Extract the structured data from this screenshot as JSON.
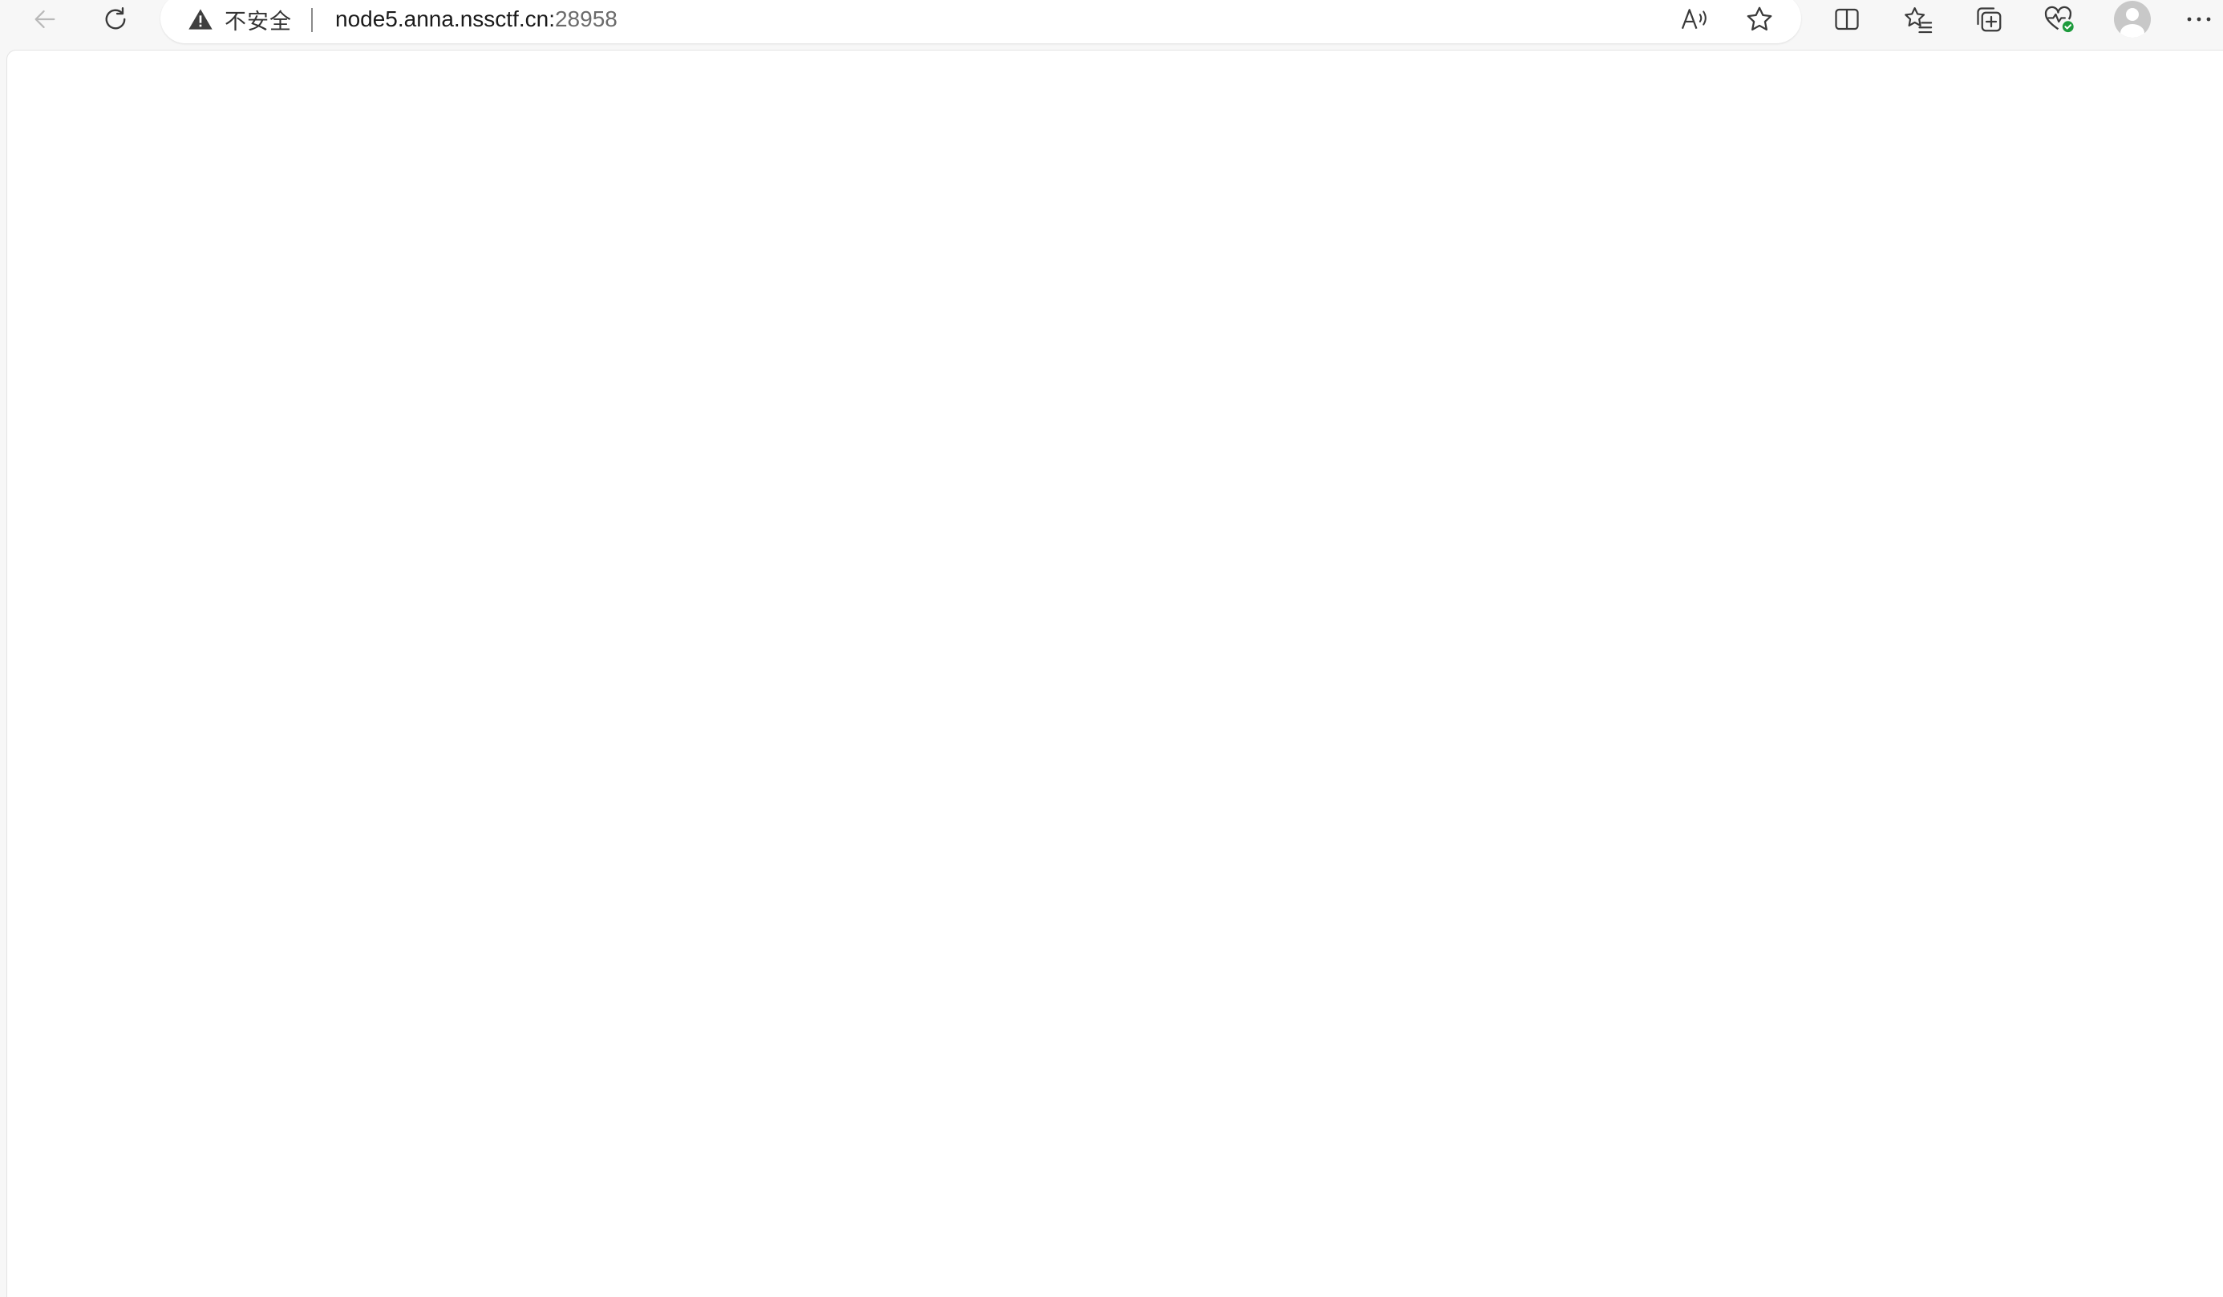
{
  "browser": {
    "security": {
      "label": "不安全",
      "icon": "warning-triangle-icon"
    },
    "url": {
      "host": "node5.anna.nssctf.cn:",
      "port": "28958"
    },
    "toolbar": {
      "back_icon": "back-arrow-icon",
      "refresh_icon": "refresh-icon",
      "read_aloud_icon": "read-aloud-icon",
      "favorite_icon": "star-icon",
      "split_screen_icon": "split-screen-icon",
      "favorites_icon": "favorites-list-icon",
      "collections_icon": "collections-icon",
      "browser_essentials_icon": "heartbeat-icon",
      "profile_icon": "profile-avatar-icon",
      "more_icon": "more-menu-icon"
    },
    "colors": {
      "toolbar_bg": "#f7f7f7",
      "page_bg": "#ffffff",
      "text": "#1a1a1a",
      "port_text": "#6b6b6b",
      "status_ok": "#1e9b3d"
    }
  },
  "page": {
    "content": ""
  }
}
